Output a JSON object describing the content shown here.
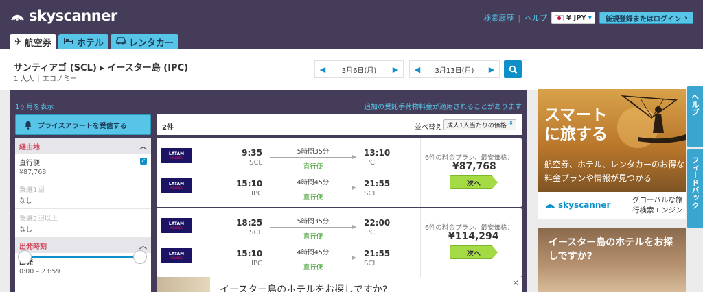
{
  "header": {
    "brand": "skyscanner",
    "links": {
      "history": "検索履歴",
      "help": "ヘルプ"
    },
    "currency": "¥ JPY",
    "login": "新規登録またはログイン"
  },
  "tabs": [
    {
      "label": "航空券",
      "icon": "airplane-icon"
    },
    {
      "label": "ホテル",
      "icon": "bed-icon"
    },
    {
      "label": "レンタカー",
      "icon": "car-icon"
    }
  ],
  "search": {
    "route": "サンティアゴ (SCL) ▸ イースター島 (IPC)",
    "passengers": "1 大人 │ エコノミー",
    "depart_date": "3月6日(月)",
    "return_date": "3月13日(月)"
  },
  "results": {
    "month_link": "1ヶ月を表示",
    "fee_note": "追加の受託手荷物料金が適用されることがあります",
    "alert_button": "プライスアラートを受信する",
    "count": "2件",
    "sort_label": "並べ替え",
    "sort_value": "成人1人当たりの価格"
  },
  "filters": {
    "stops_header": "経由地",
    "stops": [
      {
        "label": "直行便",
        "price": "¥87,768"
      },
      {
        "label": "乗継1回",
        "price": "なし"
      },
      {
        "label": "乗継2回以上",
        "price": "なし"
      }
    ],
    "time_header": "出発時刻",
    "outbound_label": "出発",
    "outbound_range": "0:00 – 23:59"
  },
  "itineraries": [
    {
      "price_label": "6件の料金プラン、最安価格：",
      "price": "¥87,768",
      "button": "次へ",
      "legs": [
        {
          "airline": "LATAM",
          "airline_sub": "AIRLINES",
          "dep": "9:35",
          "dep_ap": "SCL",
          "arr": "13:10",
          "arr_ap": "IPC",
          "duration": "5時間35分",
          "stops": "直行便"
        },
        {
          "airline": "LATAM",
          "airline_sub": "AIRLINES",
          "dep": "15:10",
          "dep_ap": "IPC",
          "arr": "21:55",
          "arr_ap": "SCL",
          "duration": "4時間45分",
          "stops": "直行便"
        }
      ]
    },
    {
      "price_label": "6件の料金プラン、最安価格：",
      "price": "¥114,294",
      "button": "次へ",
      "legs": [
        {
          "airline": "LATAM",
          "airline_sub": "AIRLINES",
          "dep": "18:25",
          "dep_ap": "SCL",
          "arr": "22:00",
          "arr_ap": "IPC",
          "duration": "5時間35分",
          "stops": "直行便"
        },
        {
          "airline": "LATAM",
          "airline_sub": "AIRLINES",
          "dep": "15:10",
          "dep_ap": "IPC",
          "arr": "21:55",
          "arr_ap": "SCL",
          "duration": "4時間45分",
          "stops": "直行便"
        }
      ]
    }
  ],
  "hotel_banner": {
    "text": "イースター島のホテルをお探しですか?",
    "close": "✕"
  },
  "ads": {
    "smart": {
      "headline_1": "スマート",
      "headline_2": "に旅する",
      "body": "航空券、ホテル、レンタカーのお得な料金プランや情報が見つかる",
      "brand": "skyscanner",
      "tagline_1": "グローバルな旅",
      "tagline_2": "行検索エンジン"
    },
    "hotel": {
      "line_1": "イースター島のホテルをお探",
      "line_2": "しですか?"
    }
  },
  "side_tabs": {
    "help": "ヘルプ",
    "feedback": "フィードバック"
  },
  "colors": {
    "header_bg": "#453c5a",
    "accent": "#57c5e8",
    "link_blue": "#0d8fc9",
    "cta_green": "#a4da43",
    "direct_green": "#3fa12f"
  }
}
